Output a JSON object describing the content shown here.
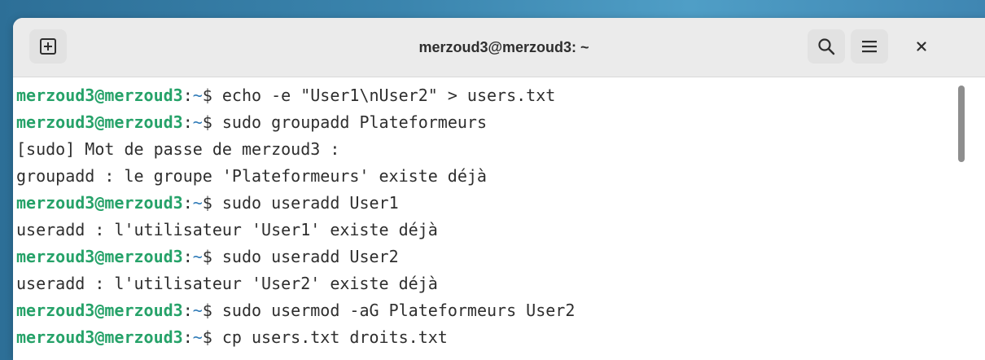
{
  "window": {
    "title": "merzoud3@merzoud3: ~"
  },
  "icons": {
    "new_tab": "new-tab-icon",
    "search": "search-icon",
    "menu": "hamburger-menu-icon",
    "close": "close-icon"
  },
  "colors": {
    "prompt_user": "#26a269",
    "prompt_path": "#2e7ab7",
    "text": "#2e2e2e"
  },
  "terminal": {
    "lines": [
      {
        "user": "merzoud3@merzoud3",
        "sep": ":",
        "path": "~",
        "text": "$ echo -e \"User1\\nUser2\" > users.txt"
      },
      {
        "user": "merzoud3@merzoud3",
        "sep": ":",
        "path": "~",
        "text": "$ sudo groupadd Plateformeurs"
      },
      {
        "text": "[sudo] Mot de passe de merzoud3 :"
      },
      {
        "text": "groupadd : le groupe 'Plateformeurs' existe déjà"
      },
      {
        "user": "merzoud3@merzoud3",
        "sep": ":",
        "path": "~",
        "text": "$ sudo useradd User1"
      },
      {
        "text": "useradd : l'utilisateur 'User1' existe déjà"
      },
      {
        "user": "merzoud3@merzoud3",
        "sep": ":",
        "path": "~",
        "text": "$ sudo useradd User2"
      },
      {
        "text": "useradd : l'utilisateur 'User2' existe déjà"
      },
      {
        "user": "merzoud3@merzoud3",
        "sep": ":",
        "path": "~",
        "text": "$ sudo usermod -aG Plateformeurs User2"
      },
      {
        "user": "merzoud3@merzoud3",
        "sep": ":",
        "path": "~",
        "text": "$ cp users.txt droits.txt"
      }
    ]
  }
}
